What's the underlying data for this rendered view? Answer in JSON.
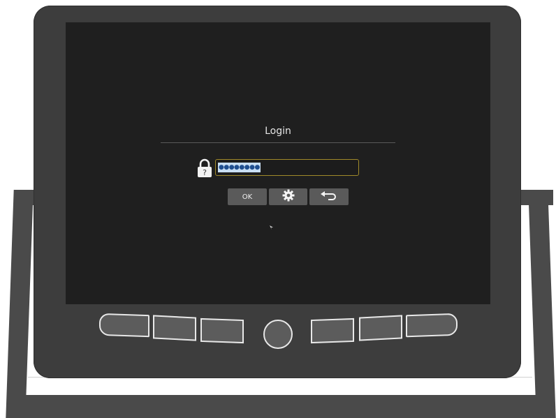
{
  "dialog": {
    "title": "Login",
    "password_value": "●●●●●●●●",
    "password_hint_glyph": "?"
  },
  "buttons": {
    "ok_label": "OK"
  },
  "icons": {
    "lock": "lock-icon",
    "settings": "gear-icon",
    "back": "back-arrow-icon"
  },
  "colors": {
    "screen_bg": "#1f1f1f",
    "device_body": "#3d3d3d",
    "field_border": "#a08a2a",
    "selection_bg": "#c9dff4",
    "button_bg": "#5a5a5a"
  }
}
